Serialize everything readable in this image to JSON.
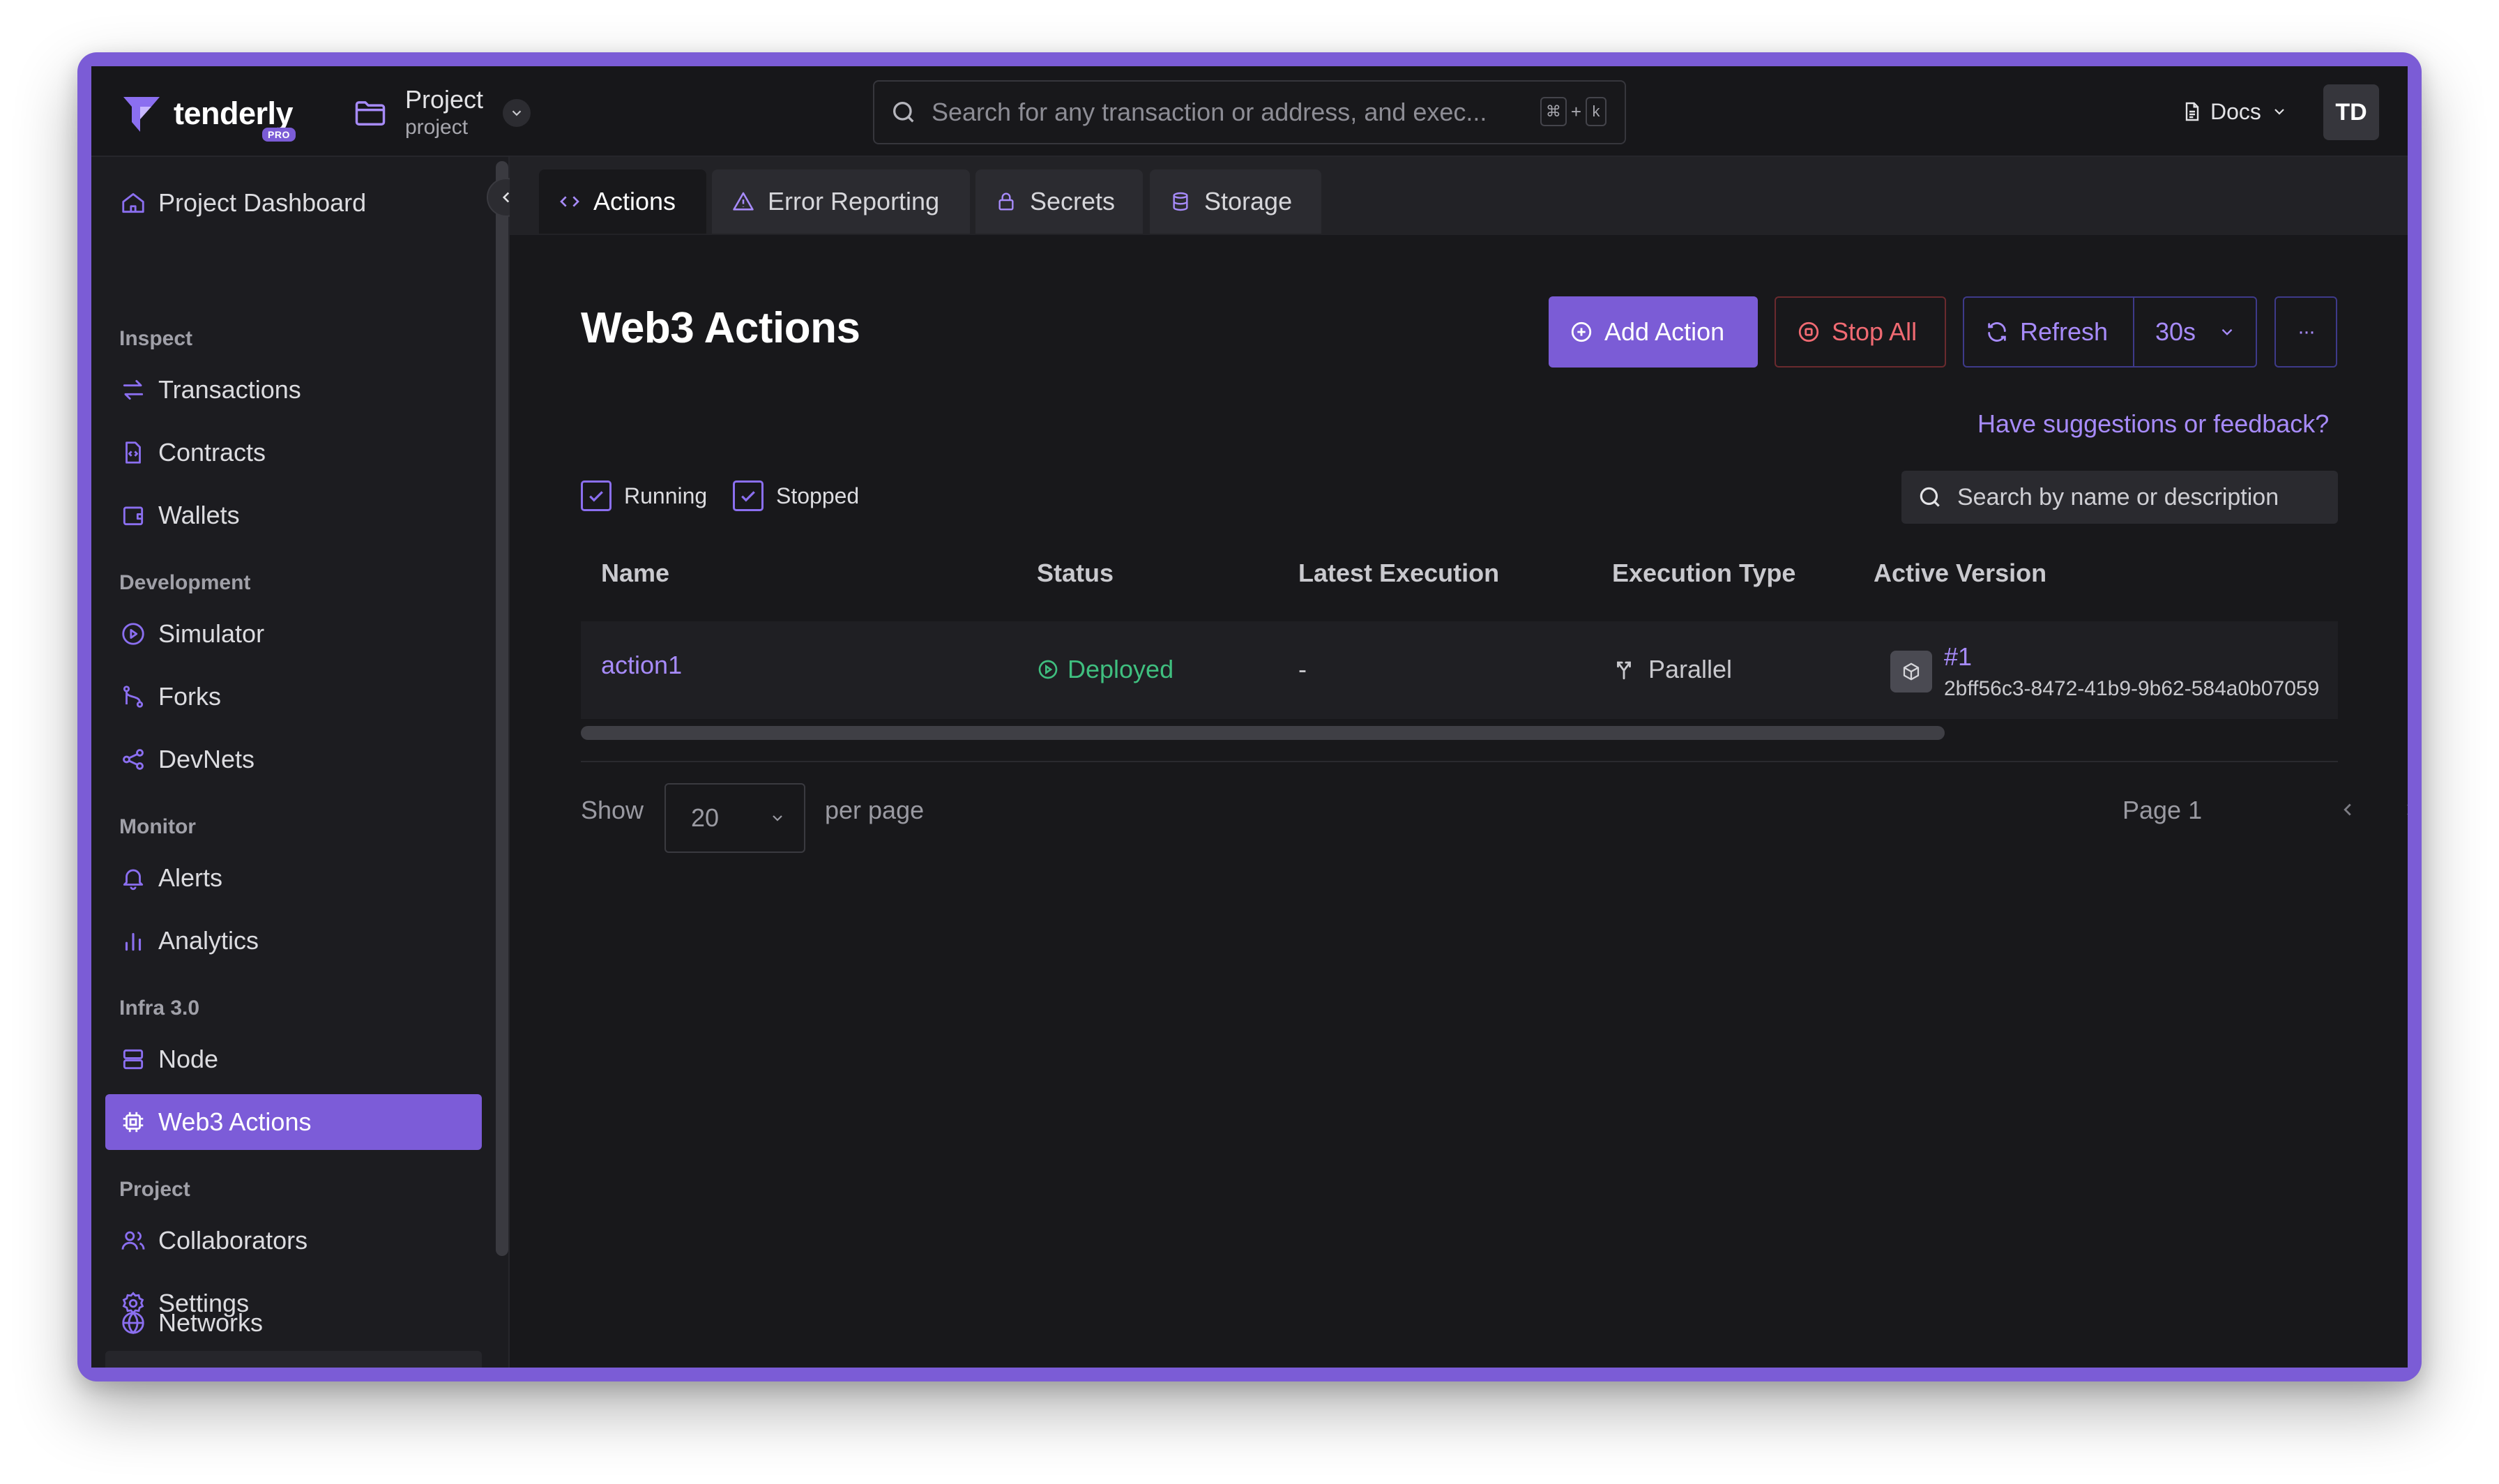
{
  "brand": {
    "name": "tenderly",
    "badge": "PRO"
  },
  "project": {
    "title": "Project",
    "slug": "project"
  },
  "search": {
    "placeholder": "Search for any transaction or address, and exec...",
    "shortcut_mod": "⌘",
    "shortcut_plus": "+",
    "shortcut_key": "k"
  },
  "header": {
    "docs_label": "Docs",
    "avatar_initials": "TD"
  },
  "sidebar": {
    "dashboard": "Project Dashboard",
    "sections": {
      "inspect": "Inspect",
      "development": "Development",
      "monitor": "Monitor",
      "infra": "Infra 3.0",
      "project": "Project"
    },
    "items": {
      "transactions": "Transactions",
      "contracts": "Contracts",
      "wallets": "Wallets",
      "simulator": "Simulator",
      "forks": "Forks",
      "devnets": "DevNets",
      "alerts": "Alerts",
      "analytics": "Analytics",
      "node": "Node",
      "web3_actions": "Web3 Actions",
      "collaborators": "Collaborators",
      "settings": "Settings",
      "networks": "Networks"
    }
  },
  "tabs": [
    "Actions",
    "Error Reporting",
    "Secrets",
    "Storage"
  ],
  "page": {
    "title": "Web3 Actions",
    "add_action": "Add Action",
    "stop_all": "Stop All",
    "refresh": "Refresh",
    "interval": "30s",
    "more": "···",
    "feedback": "Have suggestions or feedback?"
  },
  "filters": {
    "running": "Running",
    "stopped": "Stopped",
    "search_placeholder": "Search by name or description"
  },
  "table": {
    "columns": [
      "Name",
      "Status",
      "Latest Execution",
      "Execution Type",
      "Active Version"
    ],
    "rows": [
      {
        "name": "action1",
        "status": "Deployed",
        "latest_execution": "-",
        "execution_type": "Parallel",
        "version": "#1",
        "version_hash": "2bff56c3-8472-41b9-9b62-584a0b07059"
      }
    ]
  },
  "pagination": {
    "show": "Show",
    "per_page_value": "20",
    "per_page": "per page",
    "page": "Page 1"
  },
  "colors": {
    "accent": "#7b5cd6",
    "link": "#a78bfa",
    "danger": "#f06a72",
    "success": "#3fbf7f",
    "bg": "#18181b"
  }
}
